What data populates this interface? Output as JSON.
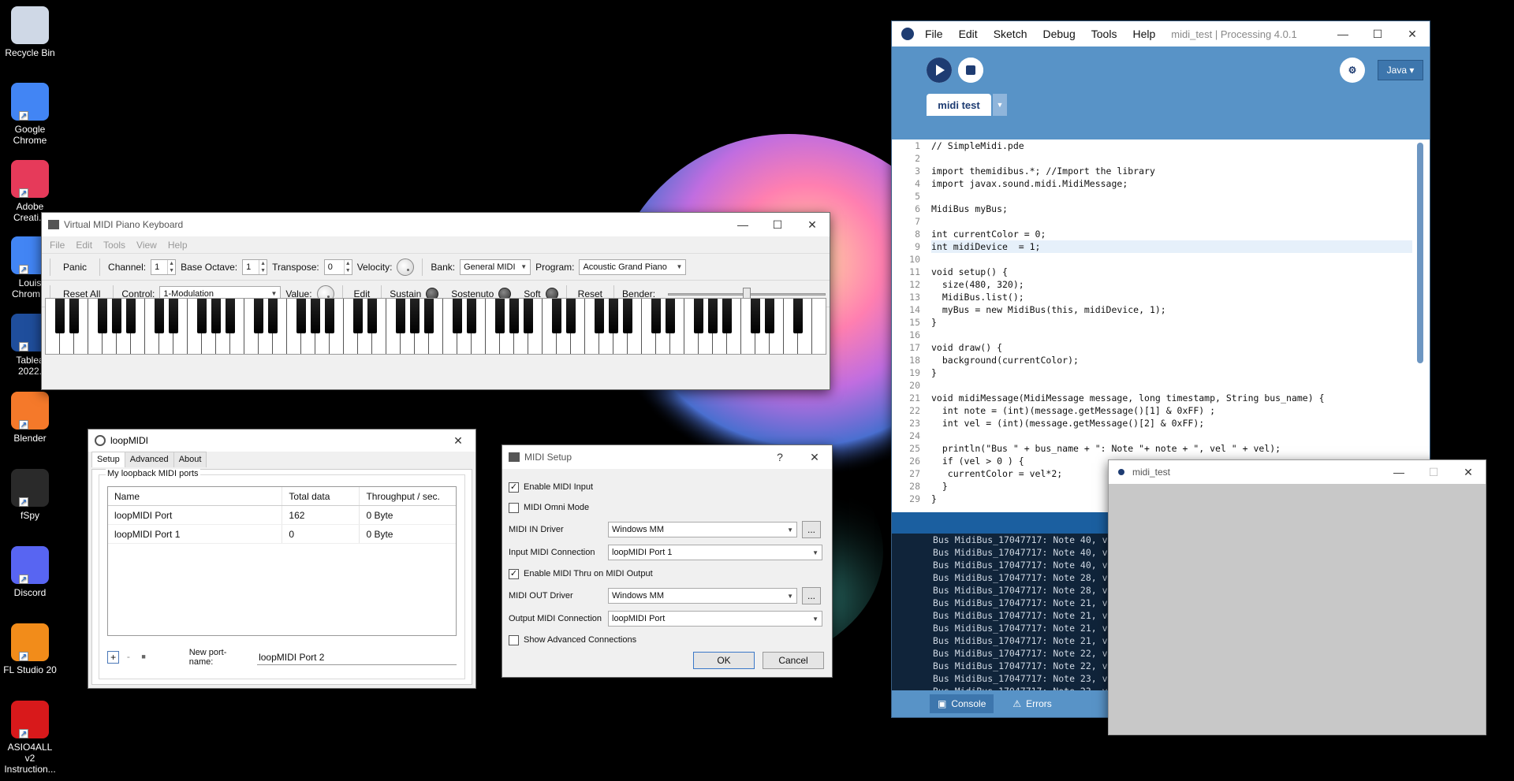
{
  "desktop": {
    "icons": [
      {
        "label": "Recycle Bin",
        "icon": "recycle-bin-icon",
        "color": "#cfd8e6"
      },
      {
        "label": "Google Chrome",
        "icon": "chrome-icon",
        "color": "#4285f4"
      },
      {
        "label": "Adobe Creati...",
        "icon": "adobe-cc-icon",
        "color": "#e63a5a"
      },
      {
        "label": "Louis Chrom...",
        "icon": "chrome-icon",
        "color": "#4285f4"
      },
      {
        "label": "Tablea 2022.",
        "icon": "tableau-icon",
        "color": "#1f4e9c"
      },
      {
        "label": "Blender",
        "icon": "blender-icon",
        "color": "#f5792a"
      },
      {
        "label": "fSpy",
        "icon": "fspy-icon",
        "color": "#2a2a2a"
      },
      {
        "label": "Discord",
        "icon": "discord-icon",
        "color": "#5865f2"
      },
      {
        "label": "FL Studio 20",
        "icon": "fl-studio-icon",
        "color": "#f28c1a"
      },
      {
        "label": "ASIO4ALL v2 Instruction...",
        "icon": "pdf-icon",
        "color": "#d8191b"
      }
    ]
  },
  "vmpk": {
    "title": "Virtual MIDI Piano Keyboard",
    "menu": [
      "File",
      "Edit",
      "Tools",
      "View",
      "Help"
    ],
    "toolbar1": {
      "panic": "Panic",
      "channel_label": "Channel:",
      "channel": "1",
      "octave_label": "Base Octave:",
      "octave": "1",
      "transpose_label": "Transpose:",
      "transpose": "0",
      "velocity_label": "Velocity:",
      "bank_label": "Bank:",
      "bank": "General MIDI",
      "program_label": "Program:",
      "program": "Acoustic Grand Piano"
    },
    "toolbar2": {
      "reset_all": "Reset All",
      "control_label": "Control:",
      "control": "1-Modulation",
      "value_label": "Value:",
      "edit": "Edit",
      "sustain": "Sustain",
      "sostenuto": "Sostenuto",
      "soft": "Soft",
      "reset": "Reset",
      "bender_label": "Bender:",
      "bender_value": 0.5
    }
  },
  "loopmidi": {
    "title": "loopMIDI",
    "tabs": [
      "Setup",
      "Advanced",
      "About"
    ],
    "group_label": "My loopback MIDI ports",
    "columns": [
      "Name",
      "Total data",
      "Throughput / sec."
    ],
    "rows": [
      [
        "loopMIDI Port",
        "162",
        "0 Byte"
      ],
      [
        "loopMIDI Port 1",
        "0",
        "0 Byte"
      ]
    ],
    "add": "+",
    "remove": "-",
    "square": "■",
    "new_port_label": "New port-name:",
    "new_port_value": "loopMIDI Port 2"
  },
  "midisetup": {
    "title": "MIDI Setup",
    "help": "?",
    "enable_input": "Enable MIDI Input",
    "omni": "MIDI Omni Mode",
    "in_driver_label": "MIDI IN Driver",
    "in_driver": "Windows MM",
    "input_conn_label": "Input MIDI Connection",
    "input_conn": "loopMIDI Port 1",
    "thru": "Enable MIDI Thru on MIDI Output",
    "out_driver_label": "MIDI OUT Driver",
    "out_driver": "Windows MM",
    "output_conn_label": "Output MIDI Connection",
    "output_conn": "loopMIDI Port",
    "advanced": "Show Advanced Connections",
    "ellipsis": "...",
    "ok": "OK",
    "cancel": "Cancel"
  },
  "processing": {
    "menu": [
      "File",
      "Edit",
      "Sketch",
      "Debug",
      "Tools",
      "Help"
    ],
    "title": "midi_test | Processing 4.0.1",
    "mode": "Java ▾",
    "tab": "midi test",
    "code": [
      "// SimpleMidi.pde",
      "",
      "import themidibus.*; //Import the library",
      "import javax.sound.midi.MidiMessage;",
      "",
      "MidiBus myBus;",
      "",
      "int currentColor = 0;",
      "int midiDevice  = 1;",
      "",
      "void setup() {",
      "  size(480, 320);",
      "  MidiBus.list();",
      "  myBus = new MidiBus(this, midiDevice, 1);",
      "}",
      "",
      "void draw() {",
      "  background(currentColor);",
      "}",
      "",
      "void midiMessage(MidiMessage message, long timestamp, String bus_name) {",
      "  int note = (int)(message.getMessage()[1] & 0xFF) ;",
      "  int vel = (int)(message.getMessage()[2] & 0xFF);",
      "",
      "  println(\"Bus \" + bus_name + \": Note \"+ note + \", vel \" + vel);",
      "  if (vel > 0 ) {",
      "   currentColor = vel*2;",
      "  }",
      "}"
    ],
    "line_numbers": [
      "1",
      "2",
      "3",
      "4",
      "5",
      "6",
      "7",
      "8",
      "9",
      "10",
      "11",
      "12",
      "13",
      "14",
      "15",
      "16",
      "17",
      "18",
      "19",
      "20",
      "21",
      "22",
      "23",
      "24",
      "25",
      "26",
      "27",
      "28",
      "29"
    ],
    "console": [
      "Bus MidiBus_17047717: Note 40, v",
      "Bus MidiBus_17047717: Note 40, v",
      "Bus MidiBus_17047717: Note 40, v",
      "Bus MidiBus_17047717: Note 28, v",
      "Bus MidiBus_17047717: Note 28, v",
      "Bus MidiBus_17047717: Note 21, v",
      "Bus MidiBus_17047717: Note 21, v",
      "Bus MidiBus_17047717: Note 21, v",
      "Bus MidiBus_17047717: Note 21, v",
      "Bus MidiBus_17047717: Note 22, v",
      "Bus MidiBus_17047717: Note 22, v",
      "Bus MidiBus_17047717: Note 23, v",
      "Bus MidiBus_17047717: Note 23, v"
    ],
    "console_tab": "Console",
    "errors_tab": "Errors",
    "accent": "#5893c7"
  },
  "sketch_window": {
    "title": "midi_test"
  }
}
